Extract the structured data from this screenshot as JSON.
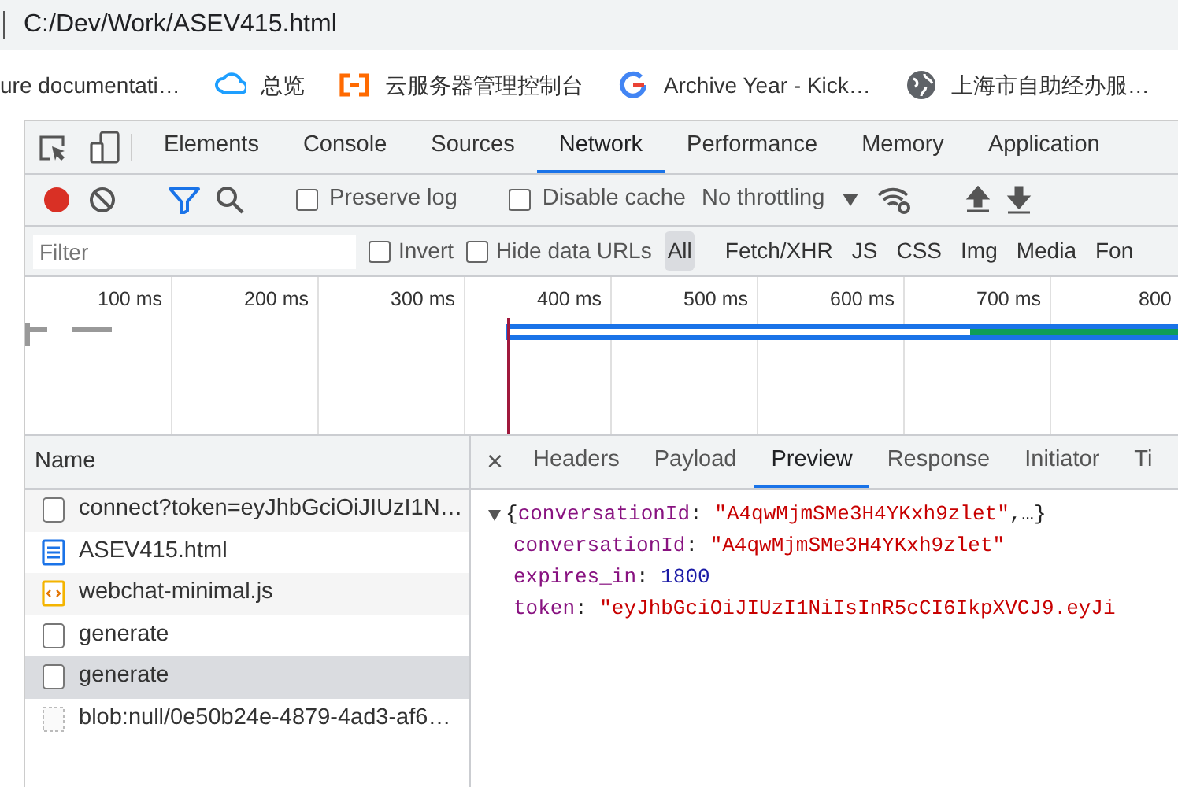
{
  "address_bar": {
    "url": "C:/Dev/Work/ASEV415.html"
  },
  "bookmarks": [
    {
      "label": "ure documentati…",
      "kind": "none"
    },
    {
      "label": "总览",
      "kind": "cloud"
    },
    {
      "label": "云服务器管理控制台",
      "kind": "bracket"
    },
    {
      "label": "Archive Year - Kick…",
      "kind": "google"
    },
    {
      "label": "上海市自助经办服…",
      "kind": "globe"
    }
  ],
  "devtools": {
    "tabs": [
      {
        "label": "Elements",
        "selected": false
      },
      {
        "label": "Console",
        "selected": false
      },
      {
        "label": "Sources",
        "selected": false
      },
      {
        "label": "Network",
        "selected": true
      },
      {
        "label": "Performance",
        "selected": false
      },
      {
        "label": "Memory",
        "selected": false
      },
      {
        "label": "Application",
        "selected": false
      }
    ],
    "toolbar": {
      "recording": true,
      "filter_active": true,
      "preserve_log": {
        "label": "Preserve log",
        "checked": false
      },
      "disable_cache": {
        "label": "Disable cache",
        "checked": false
      },
      "throttling": "No throttling"
    },
    "filter": {
      "placeholder": "Filter",
      "invert": {
        "label": "Invert",
        "checked": false
      },
      "hide_data_urls": {
        "label": "Hide data URLs",
        "checked": false
      },
      "types": [
        {
          "label": "All",
          "selected": true
        },
        {
          "label": "Fetch/XHR",
          "selected": false
        },
        {
          "label": "JS",
          "selected": false
        },
        {
          "label": "CSS",
          "selected": false
        },
        {
          "label": "Img",
          "selected": false
        },
        {
          "label": "Media",
          "selected": false
        },
        {
          "label": "Fon",
          "selected": false
        }
      ]
    },
    "timeline": {
      "ticks": [
        "100 ms",
        "200 ms",
        "300 ms",
        "400 ms",
        "500 ms",
        "600 ms",
        "700 ms",
        "800"
      ]
    },
    "requests": {
      "header": "Name",
      "rows": [
        {
          "name": "connect?token=eyJhbGciOiJIUzI1N…",
          "kind": "other",
          "selected": false
        },
        {
          "name": "ASEV415.html",
          "kind": "document",
          "selected": false
        },
        {
          "name": "webchat-minimal.js",
          "kind": "script",
          "selected": false
        },
        {
          "name": "generate",
          "kind": "other",
          "selected": false
        },
        {
          "name": "generate",
          "kind": "other",
          "selected": true
        },
        {
          "name": "blob:null/0e50b24e-4879-4ad3-af6…",
          "kind": "blob",
          "selected": false
        }
      ]
    },
    "detail": {
      "close": "×",
      "tabs": [
        {
          "label": "Headers",
          "selected": false
        },
        {
          "label": "Payload",
          "selected": false
        },
        {
          "label": "Preview",
          "selected": true
        },
        {
          "label": "Response",
          "selected": false
        },
        {
          "label": "Initiator",
          "selected": false
        },
        {
          "label": "Ti",
          "selected": false
        }
      ],
      "preview": {
        "expanded": true,
        "summary": {
          "open": "{",
          "key": "conversationId",
          "separator": ":",
          "value": "\"A4qwMjmSMe3H4YKxh9zlet\"",
          "close": ",…}"
        },
        "fields": [
          {
            "key": "conversationId",
            "separator": ":",
            "value": "\"A4qwMjmSMe3H4YKxh9zlet\"",
            "kind": "string"
          },
          {
            "key": "expires_in",
            "separator": ":",
            "value": "1800",
            "kind": "number"
          },
          {
            "key": "token",
            "separator": ":",
            "value": "\"eyJhbGciOiJIUzI1NiIsInR5cCI6IkpXVCJ9.eyJi",
            "kind": "string"
          }
        ]
      }
    }
  }
}
